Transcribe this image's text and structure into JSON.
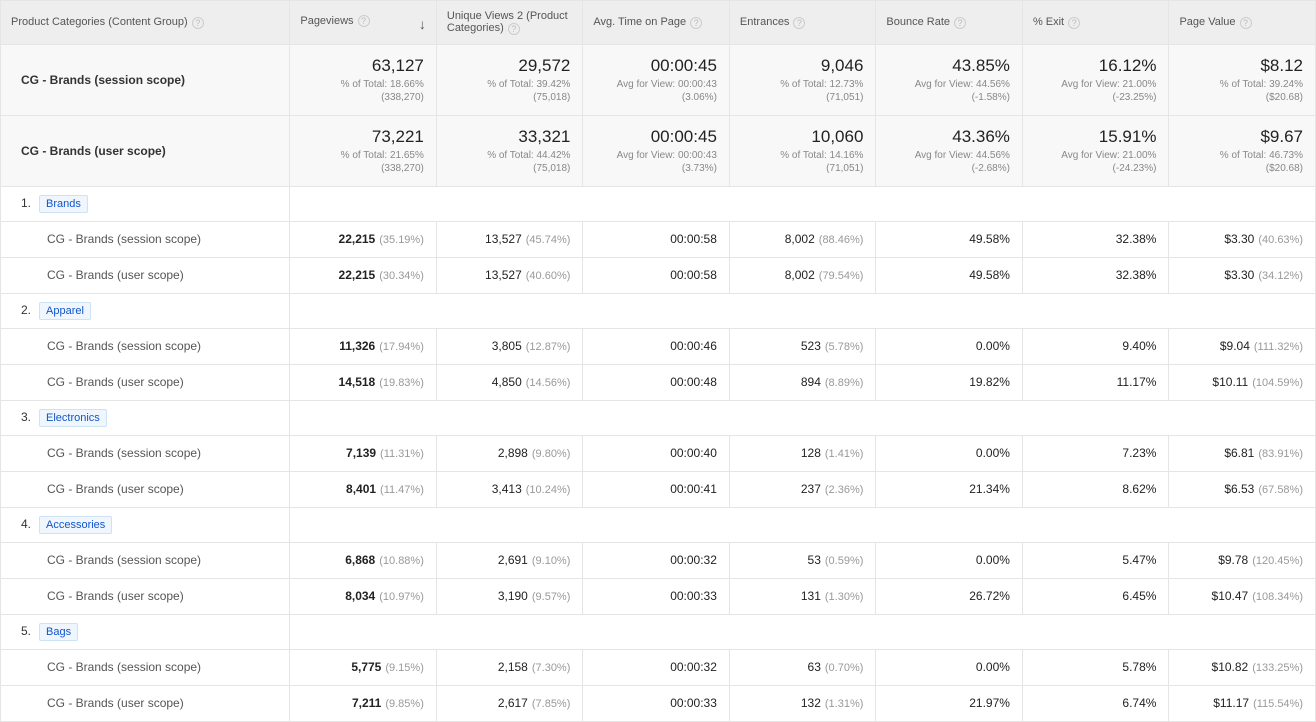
{
  "columns": [
    {
      "label": "Product Categories (Content Group)",
      "sort": false
    },
    {
      "label": "Pageviews",
      "sort": true
    },
    {
      "label": "Unique Views 2 (Product Categories)",
      "sort": false
    },
    {
      "label": "Avg. Time on Page",
      "sort": false
    },
    {
      "label": "Entrances",
      "sort": false
    },
    {
      "label": "Bounce Rate",
      "sort": false
    },
    {
      "label": "% Exit",
      "sort": false
    },
    {
      "label": "Page Value",
      "sort": false
    }
  ],
  "summary": [
    {
      "label": "CG - Brands (session scope)",
      "cells": [
        {
          "big": "63,127",
          "small1": "% of Total: 18.66%",
          "small2": "(338,270)"
        },
        {
          "big": "29,572",
          "small1": "% of Total: 39.42% (75,018)",
          "small2": ""
        },
        {
          "big": "00:00:45",
          "small1": "Avg for View: 00:00:43",
          "small2": "(3.06%)"
        },
        {
          "big": "9,046",
          "small1": "% of Total: 12.73%",
          "small2": "(71,051)"
        },
        {
          "big": "43.85%",
          "small1": "Avg for View: 44.56%",
          "small2": "(-1.58%)"
        },
        {
          "big": "16.12%",
          "small1": "Avg for View: 21.00%",
          "small2": "(-23.25%)"
        },
        {
          "big": "$8.12",
          "small1": "% of Total: 39.24%",
          "small2": "($20.68)"
        }
      ]
    },
    {
      "label": "CG - Brands (user scope)",
      "cells": [
        {
          "big": "73,221",
          "small1": "% of Total: 21.65%",
          "small2": "(338,270)"
        },
        {
          "big": "33,321",
          "small1": "% of Total: 44.42% (75,018)",
          "small2": ""
        },
        {
          "big": "00:00:45",
          "small1": "Avg for View: 00:00:43",
          "small2": "(3.73%)"
        },
        {
          "big": "10,060",
          "small1": "% of Total: 14.16%",
          "small2": "(71,051)"
        },
        {
          "big": "43.36%",
          "small1": "Avg for View: 44.56%",
          "small2": "(-2.68%)"
        },
        {
          "big": "15.91%",
          "small1": "Avg for View: 21.00%",
          "small2": "(-24.23%)"
        },
        {
          "big": "$9.67",
          "small1": "% of Total: 46.73%",
          "small2": "($20.68)"
        }
      ]
    }
  ],
  "groups": [
    {
      "idx": "1.",
      "tag": "Brands",
      "rows": [
        {
          "seg": "CG - Brands (session scope)",
          "vals": [
            {
              "b": "22,215",
              "p": "(35.19%)"
            },
            {
              "v": "13,527",
              "p": "(45.74%)"
            },
            {
              "v": "00:00:58"
            },
            {
              "v": "8,002",
              "p": "(88.46%)"
            },
            {
              "v": "49.58%"
            },
            {
              "v": "32.38%"
            },
            {
              "v": "$3.30",
              "p": "(40.63%)"
            }
          ]
        },
        {
          "seg": "CG - Brands (user scope)",
          "vals": [
            {
              "b": "22,215",
              "p": "(30.34%)"
            },
            {
              "v": "13,527",
              "p": "(40.60%)"
            },
            {
              "v": "00:00:58"
            },
            {
              "v": "8,002",
              "p": "(79.54%)"
            },
            {
              "v": "49.58%"
            },
            {
              "v": "32.38%"
            },
            {
              "v": "$3.30",
              "p": "(34.12%)"
            }
          ]
        }
      ]
    },
    {
      "idx": "2.",
      "tag": "Apparel",
      "rows": [
        {
          "seg": "CG - Brands (session scope)",
          "vals": [
            {
              "b": "11,326",
              "p": "(17.94%)"
            },
            {
              "v": "3,805",
              "p": "(12.87%)"
            },
            {
              "v": "00:00:46"
            },
            {
              "v": "523",
              "p": "(5.78%)"
            },
            {
              "v": "0.00%"
            },
            {
              "v": "9.40%"
            },
            {
              "v": "$9.04",
              "p": "(111.32%)"
            }
          ]
        },
        {
          "seg": "CG - Brands (user scope)",
          "vals": [
            {
              "b": "14,518",
              "p": "(19.83%)"
            },
            {
              "v": "4,850",
              "p": "(14.56%)"
            },
            {
              "v": "00:00:48"
            },
            {
              "v": "894",
              "p": "(8.89%)"
            },
            {
              "v": "19.82%"
            },
            {
              "v": "11.17%"
            },
            {
              "v": "$10.11",
              "p": "(104.59%)"
            }
          ]
        }
      ]
    },
    {
      "idx": "3.",
      "tag": "Electronics",
      "rows": [
        {
          "seg": "CG - Brands (session scope)",
          "vals": [
            {
              "b": "7,139",
              "p": "(11.31%)"
            },
            {
              "v": "2,898",
              "p": "(9.80%)"
            },
            {
              "v": "00:00:40"
            },
            {
              "v": "128",
              "p": "(1.41%)"
            },
            {
              "v": "0.00%"
            },
            {
              "v": "7.23%"
            },
            {
              "v": "$6.81",
              "p": "(83.91%)"
            }
          ]
        },
        {
          "seg": "CG - Brands (user scope)",
          "vals": [
            {
              "b": "8,401",
              "p": "(11.47%)"
            },
            {
              "v": "3,413",
              "p": "(10.24%)"
            },
            {
              "v": "00:00:41"
            },
            {
              "v": "237",
              "p": "(2.36%)"
            },
            {
              "v": "21.34%"
            },
            {
              "v": "8.62%"
            },
            {
              "v": "$6.53",
              "p": "(67.58%)"
            }
          ]
        }
      ]
    },
    {
      "idx": "4.",
      "tag": "Accessories",
      "rows": [
        {
          "seg": "CG - Brands (session scope)",
          "vals": [
            {
              "b": "6,868",
              "p": "(10.88%)"
            },
            {
              "v": "2,691",
              "p": "(9.10%)"
            },
            {
              "v": "00:00:32"
            },
            {
              "v": "53",
              "p": "(0.59%)"
            },
            {
              "v": "0.00%"
            },
            {
              "v": "5.47%"
            },
            {
              "v": "$9.78",
              "p": "(120.45%)"
            }
          ]
        },
        {
          "seg": "CG - Brands (user scope)",
          "vals": [
            {
              "b": "8,034",
              "p": "(10.97%)"
            },
            {
              "v": "3,190",
              "p": "(9.57%)"
            },
            {
              "v": "00:00:33"
            },
            {
              "v": "131",
              "p": "(1.30%)"
            },
            {
              "v": "26.72%"
            },
            {
              "v": "6.45%"
            },
            {
              "v": "$10.47",
              "p": "(108.34%)"
            }
          ]
        }
      ]
    },
    {
      "idx": "5.",
      "tag": "Bags",
      "rows": [
        {
          "seg": "CG - Brands (session scope)",
          "vals": [
            {
              "b": "5,775",
              "p": "(9.15%)"
            },
            {
              "v": "2,158",
              "p": "(7.30%)"
            },
            {
              "v": "00:00:32"
            },
            {
              "v": "63",
              "p": "(0.70%)"
            },
            {
              "v": "0.00%"
            },
            {
              "v": "5.78%"
            },
            {
              "v": "$10.82",
              "p": "(133.25%)"
            }
          ]
        },
        {
          "seg": "CG - Brands (user scope)",
          "vals": [
            {
              "b": "7,211",
              "p": "(9.85%)"
            },
            {
              "v": "2,617",
              "p": "(7.85%)"
            },
            {
              "v": "00:00:33"
            },
            {
              "v": "132",
              "p": "(1.31%)"
            },
            {
              "v": "21.97%"
            },
            {
              "v": "6.74%"
            },
            {
              "v": "$11.17",
              "p": "(115.54%)"
            }
          ]
        }
      ]
    }
  ]
}
